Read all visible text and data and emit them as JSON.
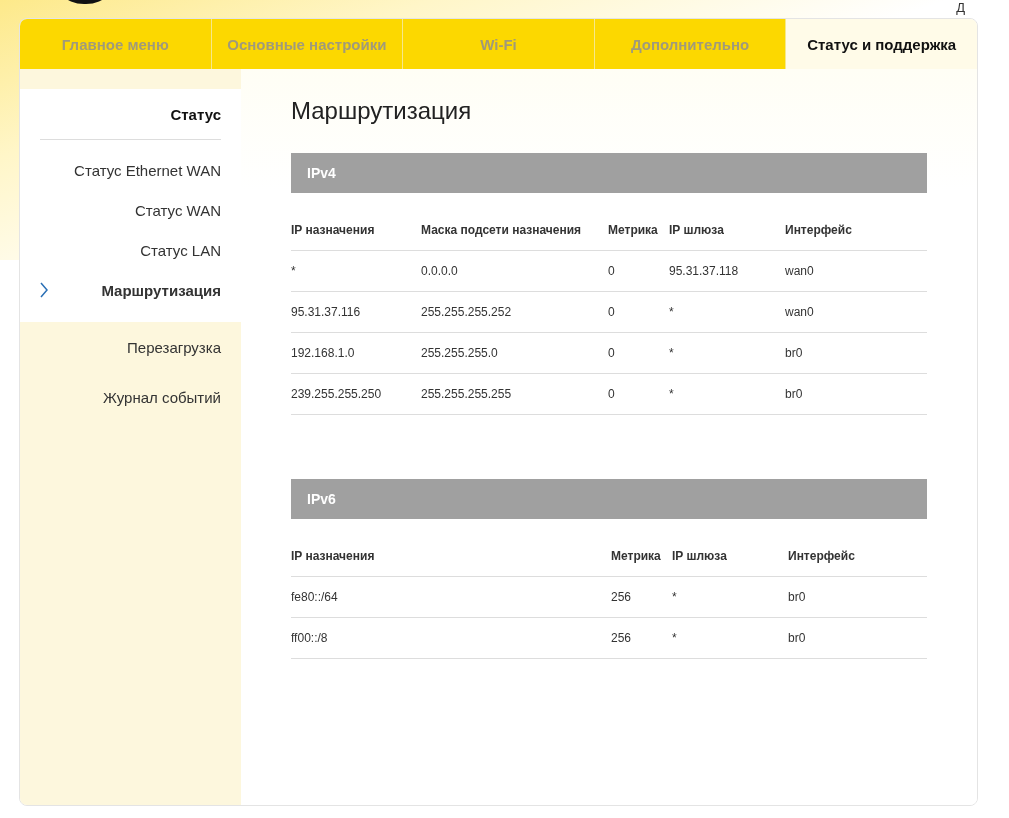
{
  "header": {
    "corner_text": "Д"
  },
  "tabs": [
    {
      "label": "Главное меню",
      "selected": false
    },
    {
      "label": "Основные настройки",
      "selected": false
    },
    {
      "label": "Wi-Fi",
      "selected": false
    },
    {
      "label": "Дополнительно",
      "selected": false
    },
    {
      "label": "Статус и поддержка",
      "selected": true
    }
  ],
  "sidebar": {
    "items": [
      {
        "label": "Статус",
        "expanded": true,
        "children": [
          {
            "label": "Статус Ethernet WAN",
            "selected": false
          },
          {
            "label": "Статус WAN",
            "selected": false
          },
          {
            "label": "Статус LAN",
            "selected": false
          },
          {
            "label": "Маршрутизация",
            "selected": true
          }
        ]
      },
      {
        "label": "Перезагрузка",
        "expanded": false
      },
      {
        "label": "Журнал событий",
        "expanded": false
      }
    ]
  },
  "page_title": "Маршрутизация",
  "tables": [
    {
      "title": "IPv4",
      "columns": [
        "IP назначения",
        "Маска подсети назначения",
        "Метрика",
        "IP шлюза",
        "Интерфейс"
      ],
      "rows": [
        [
          "*",
          "0.0.0.0",
          "0",
          "95.31.37.118",
          "wan0"
        ],
        [
          "95.31.37.116",
          "255.255.255.252",
          "0",
          "*",
          "wan0"
        ],
        [
          "192.168.1.0",
          "255.255.255.0",
          "0",
          "*",
          "br0"
        ],
        [
          "239.255.255.250",
          "255.255.255.255",
          "0",
          "*",
          "br0"
        ]
      ]
    },
    {
      "title": "IPv6",
      "columns": [
        "IP назначения",
        "Метрика",
        "IP шлюза",
        "Интерфейс"
      ],
      "rows": [
        [
          "fe80::/64",
          "256",
          "*",
          "br0"
        ],
        [
          "ff00::/8",
          "256",
          "*",
          "br0"
        ]
      ]
    }
  ]
}
